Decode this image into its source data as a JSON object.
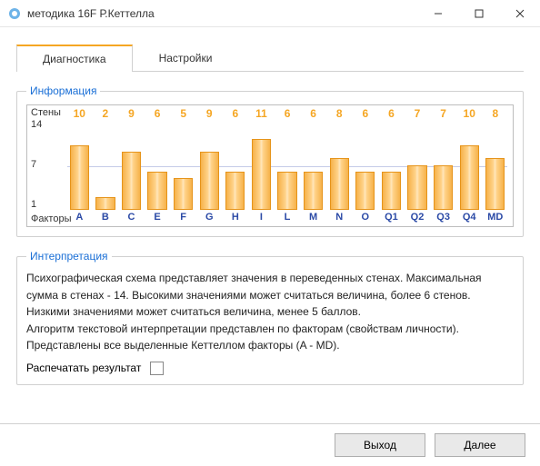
{
  "window": {
    "title": "методика 16F Р.Кеттелла"
  },
  "tabs": {
    "diagnostics": "Диагностика",
    "settings": "Настройки"
  },
  "panels": {
    "info": "Информация",
    "interp": "Интерпретация"
  },
  "chart_axes": {
    "y_header": "Стены",
    "x_header": "Факторы",
    "y_max_label": "14",
    "y_mid_label": "7",
    "y_min_label": "1"
  },
  "chart_data": {
    "type": "bar",
    "categories": [
      "A",
      "B",
      "C",
      "E",
      "F",
      "G",
      "H",
      "I",
      "L",
      "M",
      "N",
      "O",
      "Q1",
      "Q2",
      "Q3",
      "Q4",
      "MD"
    ],
    "values": [
      10,
      2,
      9,
      6,
      5,
      9,
      6,
      11,
      6,
      6,
      8,
      6,
      6,
      7,
      7,
      10,
      8
    ],
    "title": "",
    "xlabel": "Факторы",
    "ylabel": "Стены",
    "ylim": [
      1,
      14
    ]
  },
  "interpretation": {
    "p1": "Психографическая схема представляет значения в переведенных стенах. Максимальная сумма в стенах  - 14. Высокими значениями может считаться величина, более 6 стенов. Низкими значениями может считаться величина, менее 5 баллов.",
    "p2": "Алгоритм текстовой интерпретации представлен по факторам  (свойствам личности). Представлены все выделенные Кеттеллом факторы (A - MD).",
    "print_label": "Распечатать результат"
  },
  "buttons": {
    "exit": "Выход",
    "next": "Далее"
  }
}
